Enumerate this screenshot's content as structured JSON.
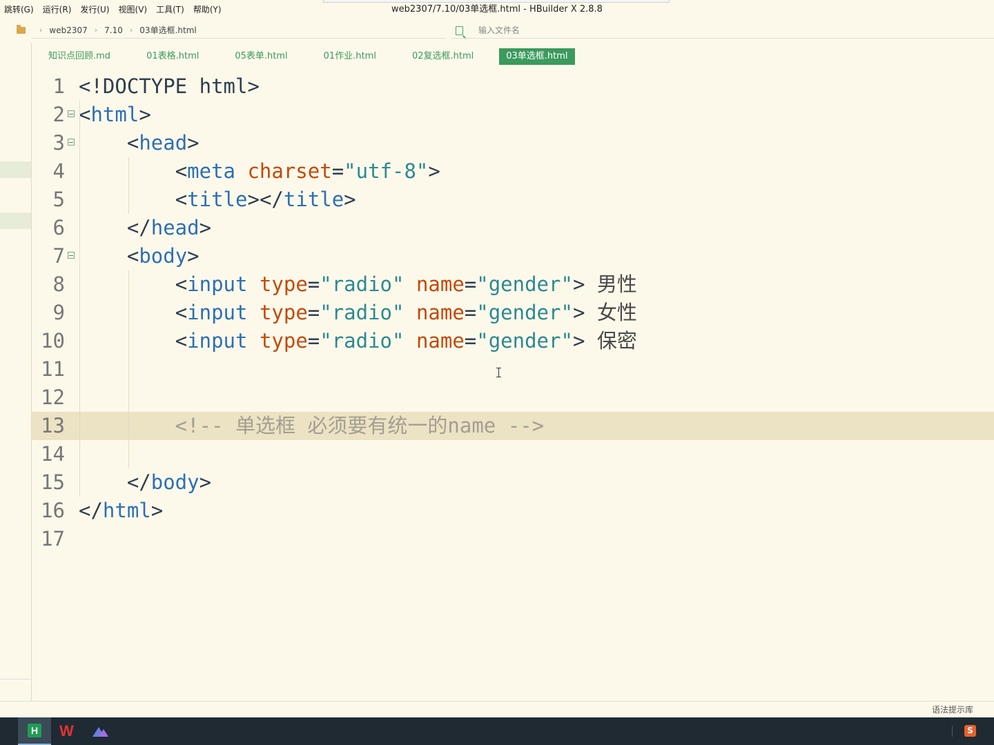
{
  "menu": [
    "跳转(G)",
    "运行(R)",
    "发行(U)",
    "视图(V)",
    "工具(T)",
    "帮助(Y)"
  ],
  "window_title": "web2307/7.10/03单选框.html - HBuilder X 2.8.8",
  "breadcrumb": [
    "web2307",
    "7.10",
    "03单选框.html"
  ],
  "file_search": {
    "placeholder": "输入文件名"
  },
  "tabs": [
    {
      "label": "知识点回顾.md",
      "active": false
    },
    {
      "label": "01表格.html",
      "active": false
    },
    {
      "label": "05表单.html",
      "active": false
    },
    {
      "label": "01作业.html",
      "active": false
    },
    {
      "label": "02复选框.html",
      "active": false
    },
    {
      "label": "03单选框.html",
      "active": true
    }
  ],
  "code_lines": [
    "<!DOCTYPE html>",
    "<html>",
    "    <head>",
    "        <meta charset=\"utf-8\">",
    "        <title></title>",
    "    </head>",
    "    <body>",
    "        <input type=\"radio\" name=\"gender\"> 男性",
    "        <input type=\"radio\" name=\"gender\"> 女性",
    "        <input type=\"radio\" name=\"gender\"> 保密",
    "",
    "",
    "        <!-- 单选框 必须要有统一的name -->",
    "",
    "    </body>",
    "</html>",
    ""
  ],
  "line_numbers": [
    "1",
    "2",
    "3",
    "4",
    "5",
    "6",
    "7",
    "8",
    "9",
    "10",
    "11",
    "12",
    "13",
    "14",
    "15",
    "16",
    "17"
  ],
  "current_line": 13,
  "status_bar": {
    "right_text": "语法提示库"
  },
  "taskbar": {
    "tray_label": "S"
  },
  "colors": {
    "background": "#fdf9ea",
    "accent": "#3b9a5c",
    "tag": "#2c6fb7",
    "attr": "#c34a0a",
    "string": "#2a8a92",
    "comment": "#a39f90",
    "current_line": "#ece2c4"
  }
}
